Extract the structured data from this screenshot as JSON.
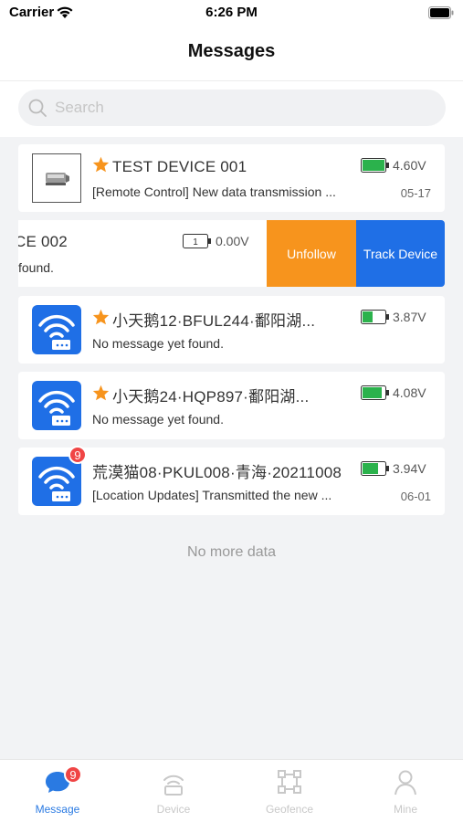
{
  "status_bar": {
    "carrier": "Carrier",
    "time": "6:26 PM"
  },
  "nav": {
    "title": "Messages"
  },
  "search": {
    "placeholder": "Search"
  },
  "messages": [
    {
      "title": "TEST DEVICE 001",
      "starred": true,
      "battery_voltage": "4.60V",
      "battery_level": 1.0,
      "battery_color": "#2bb24c",
      "message": "[Remote Control] New data transmission ...",
      "date": "05-17",
      "avatar": "device-photo"
    },
    {
      "title": "CE 002",
      "starred": false,
      "battery_voltage": "0.00V",
      "battery_text": "1",
      "message": "found."
    },
    {
      "title": "小天鹅12·BFUL244·鄱阳湖...",
      "starred": true,
      "battery_voltage": "3.87V",
      "battery_level": 0.45,
      "battery_color": "#2bb24c",
      "message": "No message yet found.",
      "avatar": "tracker-icon"
    },
    {
      "title": "小天鹅24·HQP897·鄱阳湖...",
      "starred": true,
      "battery_voltage": "4.08V",
      "battery_level": 0.85,
      "battery_color": "#2bb24c",
      "message": "No message yet found.",
      "avatar": "tracker-icon"
    },
    {
      "title": "荒漠猫08·PKUL008·青海·20211008",
      "starred": false,
      "battery_voltage": "3.94V",
      "battery_level": 0.7,
      "battery_color": "#2bb24c",
      "message": "[Location Updates] Transmitted the new ...",
      "date": "06-01",
      "avatar": "tracker-icon",
      "unread": "9"
    }
  ],
  "swipe_actions": {
    "unfollow": "Unfollow",
    "track": "Track Device"
  },
  "footer": {
    "no_more": "No more data"
  },
  "tabbar": {
    "items": [
      {
        "label": "Message",
        "icon": "message-icon",
        "badge": "9",
        "active": true
      },
      {
        "label": "Device",
        "icon": "device-icon",
        "active": false
      },
      {
        "label": "Geofence",
        "icon": "geofence-icon",
        "active": false
      },
      {
        "label": "Mine",
        "icon": "user-icon",
        "active": false
      }
    ]
  },
  "colors": {
    "accent": "#2a7ae2",
    "star": "#f7941d",
    "unfollow": "#f7941d",
    "track": "#1f6fe6",
    "badge": "#f04545"
  }
}
